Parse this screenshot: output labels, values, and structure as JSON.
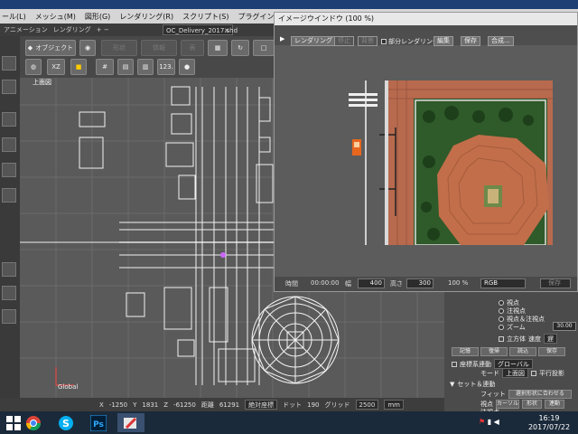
{
  "menubar": {
    "items": [
      "ール(L)",
      "メッシュ(M)",
      "図形(G)",
      "レンダリング(R)",
      "スクリプト(S)",
      "プラグイン(P)",
      "ウィ"
    ]
  },
  "tabbar": {
    "items": [
      "アニメーション",
      "レンダリング",
      "+ −"
    ],
    "doc_tab": "OC_Delivery_2017.shd",
    "close_glyph": "✕"
  },
  "toolbar": {
    "object_button": "オブジェクト",
    "dim_buttons": [
      "形状",
      "情報",
      "表"
    ],
    "numeric_label": "123."
  },
  "viewport": {
    "label": "上面図",
    "global_label": "Global"
  },
  "statusbar": {
    "x_label": "X",
    "x_value": "-1250",
    "y_label": "Y",
    "y_value": "1831",
    "z_label": "Z",
    "z_value": "-61250",
    "distance_label": "距離",
    "distance_value": "61291",
    "snap_mode": "絶対座標",
    "dot_label": "ドット",
    "dot_value": "190",
    "grid_label": "グリッド",
    "grid_value": "2500",
    "unit": "mm"
  },
  "image_window": {
    "title": "イメージウインドウ (100 %)",
    "render_button": "レンダリング",
    "dim_tools": [
      "停止",
      "背景"
    ],
    "partial_render_label": "部分レンダリング",
    "edit_menu": "編集",
    "save_menu": "保存",
    "composite_menu": "合成...",
    "time_label": "時間",
    "time_value": "00:00:00",
    "width_label": "幅",
    "width_value": "400",
    "height_label": "高さ",
    "height_value": "300",
    "zoom_value": "100 %",
    "color_mode": "RGB",
    "save_button": "保存"
  },
  "right_panel": {
    "radio_items": [
      "視点",
      "注視点",
      "視点＆注視点",
      "ズーム"
    ],
    "zoom_value": "30.00",
    "cube_label": "立方体",
    "speed_label": "速度",
    "speed_value": "遅",
    "buttons_row1": [
      "記憶",
      "復帰",
      "読込",
      "保存"
    ],
    "coord_label": "座標系連動",
    "coord_value": "グローバル",
    "mode_label": "モード",
    "mode_value": "上面図",
    "parallel_label": "平行投影",
    "section_label": "セット＆連動",
    "fit_label": "フィット",
    "fit_button": "選択形状に合わせる",
    "view_label": "視点",
    "cursor_button": "カーソル",
    "shape_button": "形状",
    "linked_button": "連動",
    "gaze_label": "注視点"
  },
  "taskbar": {
    "time": "16:19",
    "date": "2017/07/22"
  }
}
